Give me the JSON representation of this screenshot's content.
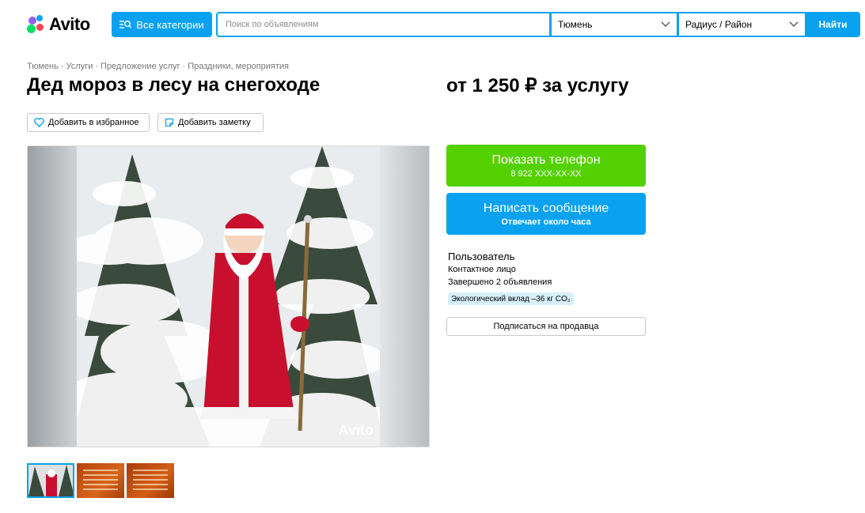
{
  "header": {
    "logo_text": "Avito",
    "categories_label": "Все категории",
    "search_placeholder": "Поиск по объявлениям",
    "city": "Тюмень",
    "radius": "Радиус / Район",
    "find_label": "Найти"
  },
  "breadcrumbs": [
    "Тюмень",
    "Услуги",
    "Предложение услуг",
    "Праздники, мероприятия"
  ],
  "listing": {
    "title": "Дед мороз в лесу на снегоходе",
    "price": "от 1 250 ₽ за услугу",
    "favorite_label": "Добавить в избранное",
    "note_label": "Добавить заметку",
    "watermark": "Avito"
  },
  "contact": {
    "phone_label": "Показать телефон",
    "phone_masked": "8 922 XXX-XX-XX",
    "message_label": "Написать сообщение",
    "message_sub": "Отвечает около часа"
  },
  "seller": {
    "name": "Пользователь",
    "role": "Контактное лицо",
    "completed": "Завершено 2 объявления",
    "eco_badge": "Экологический вклад –36 кг CO₂",
    "subscribe_label": "Подписаться на продавца"
  },
  "colors": {
    "accent": "#0aa2f0",
    "phone_green": "#54d100"
  }
}
